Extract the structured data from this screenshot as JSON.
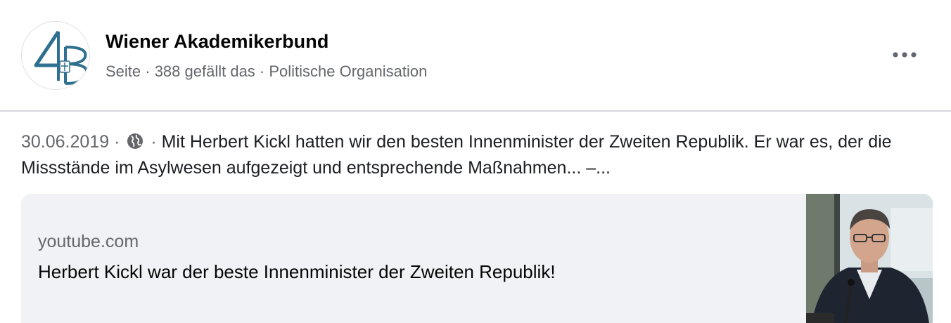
{
  "header": {
    "page_name": "Wiener Akademikerbund",
    "meta": "Seite · 388 gefällt das · Politische Organisation",
    "avatar_icon": "wab-logo-icon",
    "more_icon": "more-dots-icon"
  },
  "post": {
    "date": "30.06.2019",
    "separator": "·",
    "privacy_icon": "globe-icon",
    "text": "Mit Herbert Kickl hatten wir den besten Innenminister der Zweiten Republik. Er war es, der die Missstände im Asylwesen aufgezeigt und entsprechende Maßnahmen... –..."
  },
  "link_card": {
    "domain": "youtube.com",
    "title": "Herbert Kickl war der beste Innenminister der Zweiten Republik!",
    "thumbnail_icon": "video-thumbnail"
  },
  "colors": {
    "text_primary": "#050505",
    "text_secondary": "#65676b",
    "card_background": "#f0f2f5",
    "divider": "#d4d6da",
    "logo_blue": "#2f6f8f"
  }
}
